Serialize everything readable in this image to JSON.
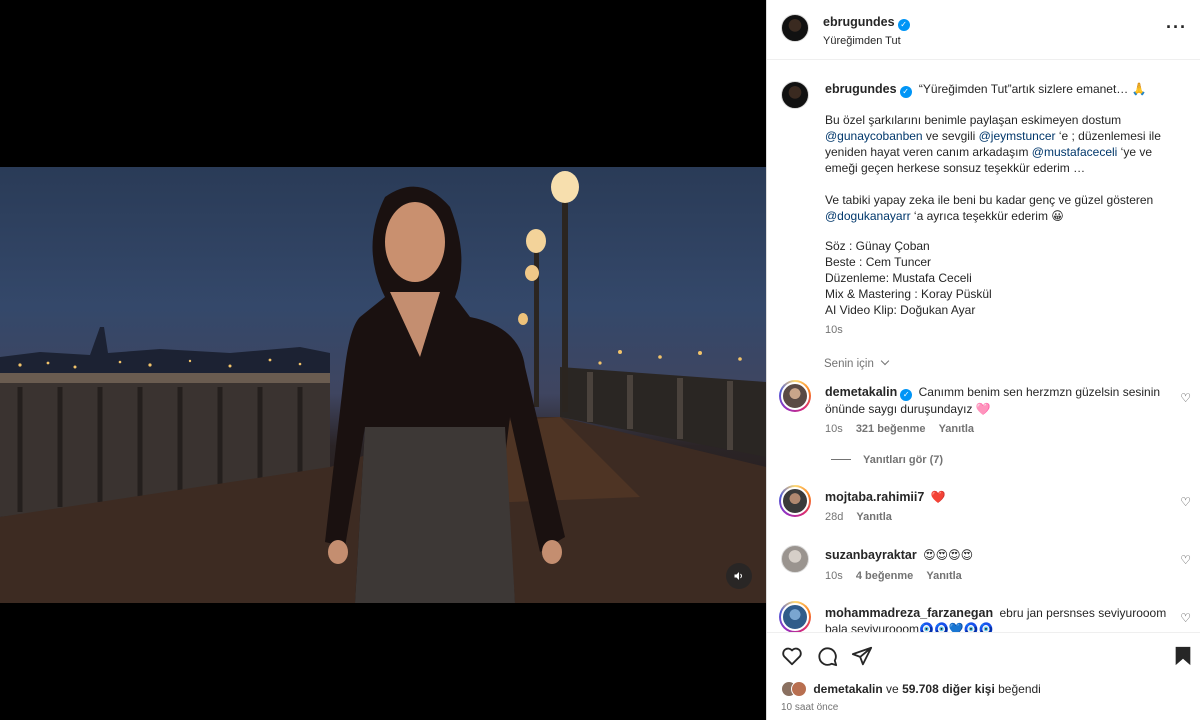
{
  "post": {
    "author": "ebrugundes",
    "subtitle": "Yüreğimden Tut"
  },
  "caption": {
    "author": "ebrugundes",
    "line1": "“Yüreğimden Tut”artık sizlere emanet… 🙏",
    "p1_a": "Bu özel şarkılarını benimle paylaşan eskimeyen dostum",
    "p1_m1": "@gunaycobanben",
    "p1_b": " ve sevgili ",
    "p1_m2": "@jeymstuncer",
    "p1_c": " ‘e ; düzenlemesi ile yeniden hayat veren canım arkadaşım ",
    "p1_m3": "@mustafaceceli",
    "p1_d": " ‘ye ve emeği geçen herkese sonsuz teşekkür ederim …",
    "p2_a": "Ve tabiki yapay zeka ile beni bu kadar genç ve güzel gösteren",
    "p2_m": "@dogukanayarr",
    "p2_b": " ‘a ayrıca teşekkür ederim 😀",
    "credits": [
      "Söz : Günay Çoban",
      "Beste : Cem Tuncer",
      "Düzenleme: Mustafa Ceceli",
      "Mix & Mastering : Koray Püskül",
      "AI Video Klip: Doğukan Ayar"
    ],
    "time": "10s"
  },
  "filter": "Senin için",
  "comments": [
    {
      "user": "demetakalin",
      "text": "Canımm benim sen herzmzn güzelsin sesinin önünde saygı duruşundayız 🩷",
      "time": "10s",
      "likes": "321 beğenme",
      "reply": "Yanıtla",
      "view_replies": "Yanıtları gör (7)"
    },
    {
      "user": "mojtaba.rahimii7",
      "text": "❤️",
      "time": "28d",
      "reply": "Yanıtla"
    },
    {
      "user": "suzanbayraktar",
      "text": "😍😍😍😍",
      "time": "10s",
      "likes": "4 beğenme",
      "reply": "Yanıtla"
    },
    {
      "user": "mohammadreza_farzanegan",
      "text": "ebru jan persnses seviyurooom bala seviyurooom🧿🧿💙🧿🧿"
    }
  ],
  "likes": {
    "user": "demetakalin",
    "connector": " ve ",
    "count": "59.708 diğer kişi",
    "suffix": " beğendi",
    "time": "10 saat önce"
  },
  "icons": {
    "more": "more-icon",
    "like": "heart-icon",
    "comment": "comment-icon",
    "share": "share-icon",
    "save": "bookmark-icon",
    "mute": "speaker-icon"
  },
  "colors": {
    "verified": "#0095f6",
    "mention": "#00376b",
    "heart": "#ed4956"
  }
}
